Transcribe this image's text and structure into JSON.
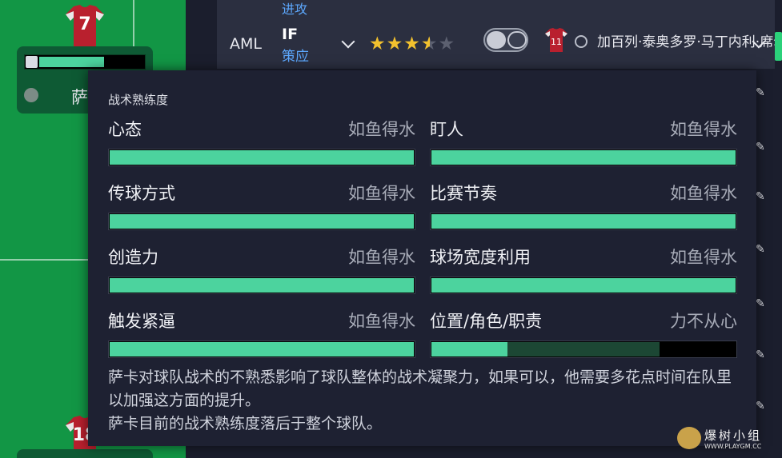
{
  "pitch": {
    "top_player_number": "7",
    "bottom_player_number": "18",
    "card": {
      "name": "萨",
      "familiarity_fill": 0.61
    }
  },
  "list": {
    "prev_row_duty": "进攻",
    "row": {
      "position": "AML",
      "role": "IF",
      "duty": "策应",
      "stars": 3.5,
      "stars_max": 5,
      "shirt_number": "11",
      "player_name": "加百列·泰奥多罗·马丁内利·席尔瓦"
    }
  },
  "panel": {
    "title": "战术熟练度",
    "metrics": [
      {
        "label": "心态",
        "value": "如鱼得水",
        "fill": 1.0,
        "secondary": 0
      },
      {
        "label": "盯人",
        "value": "如鱼得水",
        "fill": 1.0,
        "secondary": 0
      },
      {
        "label": "传球方式",
        "value": "如鱼得水",
        "fill": 1.0,
        "secondary": 0
      },
      {
        "label": "比赛节奏",
        "value": "如鱼得水",
        "fill": 1.0,
        "secondary": 0
      },
      {
        "label": "创造力",
        "value": "如鱼得水",
        "fill": 1.0,
        "secondary": 0
      },
      {
        "label": "球场宽度利用",
        "value": "如鱼得水",
        "fill": 1.0,
        "secondary": 0
      },
      {
        "label": "触发紧逼",
        "value": "如鱼得水",
        "fill": 1.0,
        "secondary": 0
      },
      {
        "label": "位置/角色/职责",
        "value": "力不从心",
        "fill": 0.25,
        "secondary": 0.75
      }
    ],
    "description_1": "萨卡对球队战术的不熟悉影响了球队整体的战术凝聚力，如果可以，他需要多花点时间在队里以加强这方面的提升。",
    "description_2": "萨卡目前的战术熟练度落后于整个球队。"
  },
  "watermark": {
    "title": "爆树小组",
    "url": "WWW.PLAYGM.CC"
  },
  "colors": {
    "pitch": "#129645",
    "familiarity_fill": "#4cd39e",
    "familiarity_secondary": "#1c4734",
    "duty_text": "#5da9ff",
    "star": "#f2c12e",
    "shirt": "#b9202e"
  },
  "icons": [
    "person-icon",
    "chevron-down-icon",
    "star-icon",
    "role-toggle-icon",
    "shirt-icon",
    "edit-icon"
  ]
}
